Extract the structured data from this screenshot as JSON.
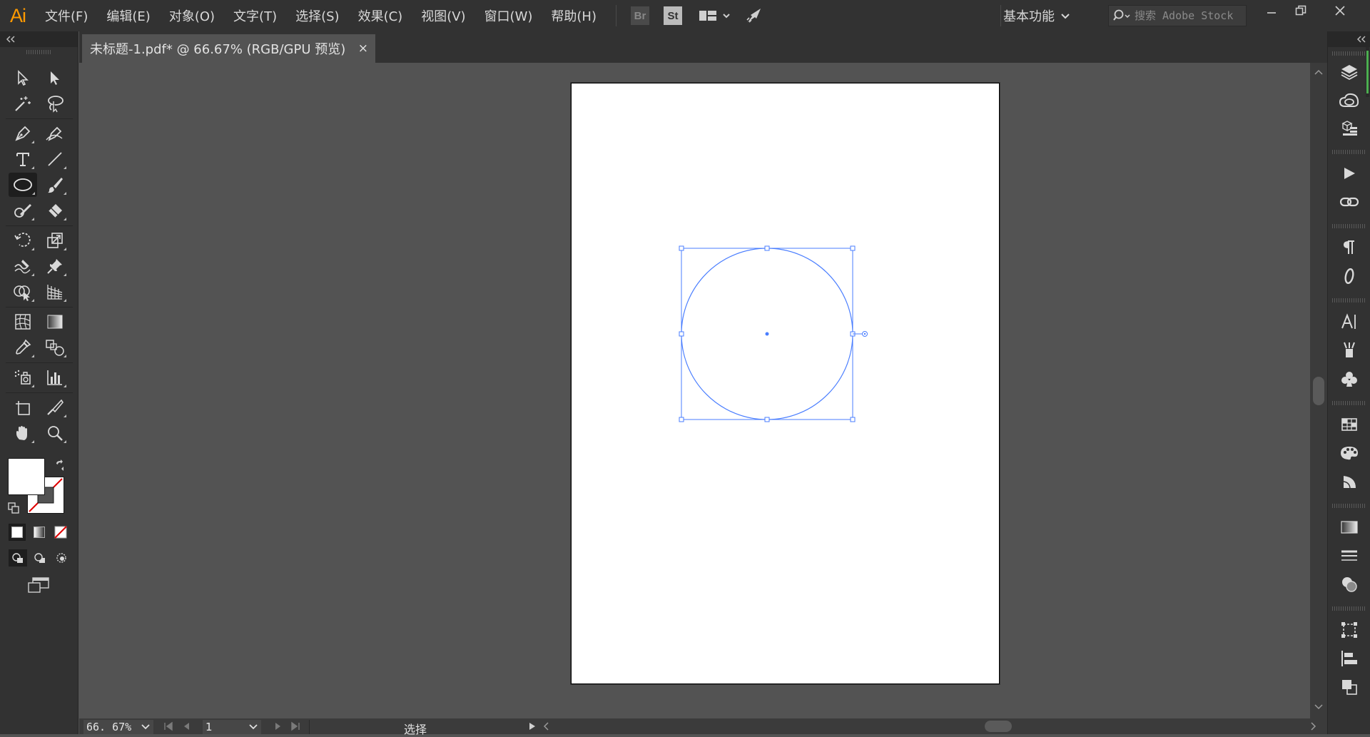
{
  "app": {
    "logo": "Ai"
  },
  "menu": [
    {
      "id": "file",
      "label": "文件(F)"
    },
    {
      "id": "edit",
      "label": "编辑(E)"
    },
    {
      "id": "object",
      "label": "对象(O)"
    },
    {
      "id": "type",
      "label": "文字(T)"
    },
    {
      "id": "select",
      "label": "选择(S)"
    },
    {
      "id": "effect",
      "label": "效果(C)"
    },
    {
      "id": "view",
      "label": "视图(V)"
    },
    {
      "id": "window",
      "label": "窗口(W)"
    },
    {
      "id": "help",
      "label": "帮助(H)"
    }
  ],
  "topbar": {
    "bridge_label": "Br",
    "stock_label": "St",
    "workspace": "基本功能",
    "search_placeholder": "搜索 Adobe Stock"
  },
  "document": {
    "tab_title": "未标题-1.pdf* @ 66.67% (RGB/GPU 预览)",
    "close_glyph": "×"
  },
  "status": {
    "zoom": "66. 67%",
    "page": "1",
    "current_tool": "选择"
  },
  "tools": {
    "active": "ellipse-tool"
  },
  "colors": {
    "accent": "#ff9a00",
    "selection": "#4a7eff",
    "chrome_dark": "#323232",
    "canvas": "#535353"
  }
}
